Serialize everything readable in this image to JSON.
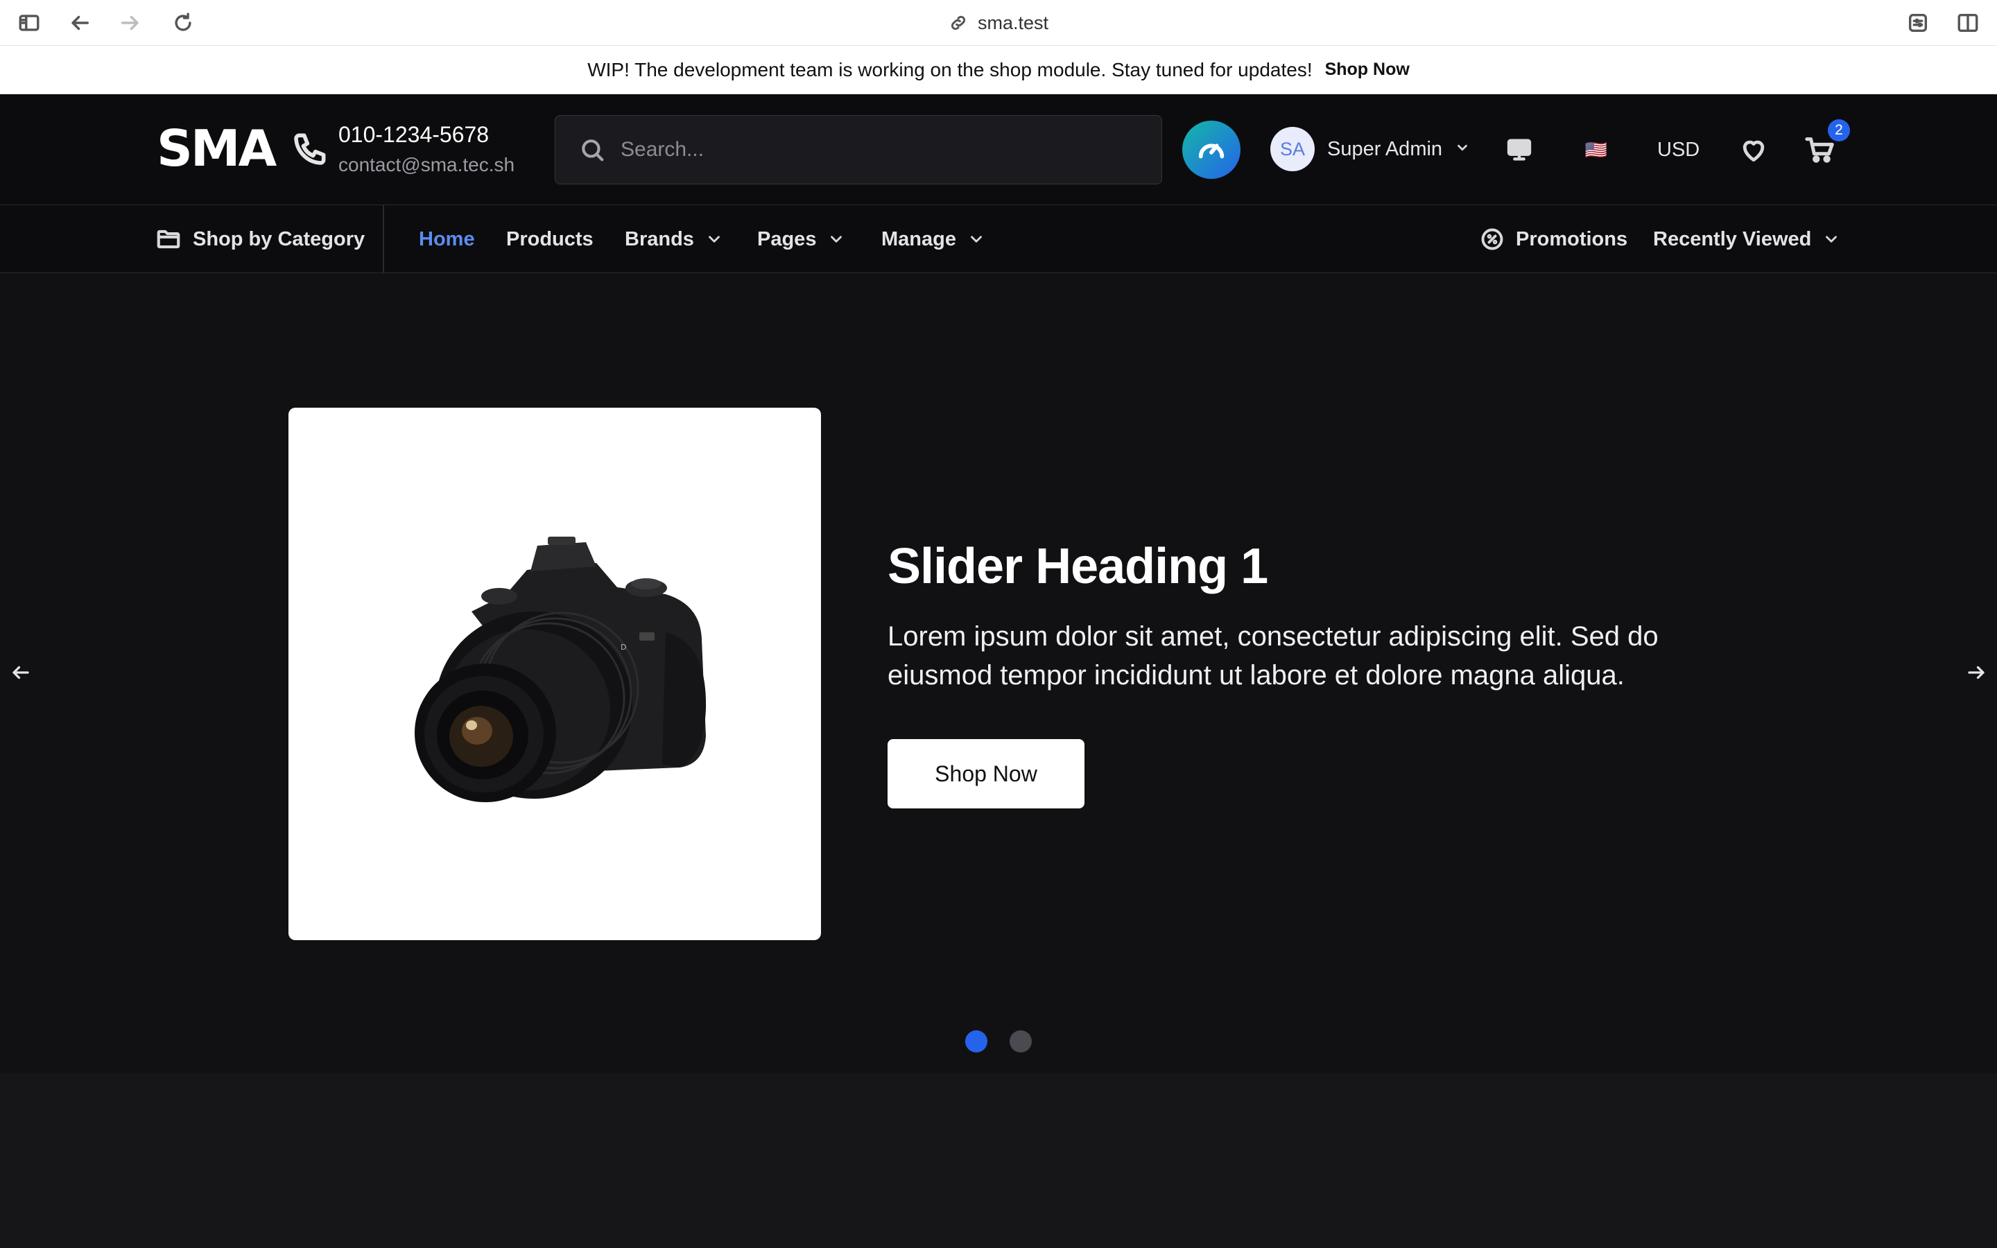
{
  "browser": {
    "url": "sma.test"
  },
  "announcement": {
    "text": "WIP! The development team is working on the shop module. Stay tuned for updates!",
    "link": "Shop Now"
  },
  "header": {
    "logo": "SMA",
    "phone": "010-1234-5678",
    "email": "contact@sma.tec.sh",
    "search_placeholder": "Search...",
    "user_initials": "SA",
    "user_name": "Super Admin",
    "currency": "USD",
    "flag": "🇺🇸",
    "cart_count": "2"
  },
  "nav": {
    "shop_by_category": "Shop by Category",
    "items": [
      {
        "label": "Home",
        "active": true
      },
      {
        "label": "Products"
      },
      {
        "label": "Brands"
      },
      {
        "label": "Pages"
      },
      {
        "label": "Manage"
      }
    ],
    "promotions": "Promotions",
    "recently_viewed": "Recently Viewed"
  },
  "hero": {
    "title": "Slider Heading 1",
    "text": "Lorem ipsum dolor sit amet, consectetur adipiscing elit. Sed do eiusmod tempor incididunt ut labore et dolore magna aliqua.",
    "button": "Shop Now",
    "image_icon": "camera-image",
    "active_slide": 1,
    "slide_count": 2
  },
  "colors": {
    "accent": "#2563eb",
    "nav_active": "#5b8def",
    "background": "#111113",
    "header_bg": "#0c0c0e"
  }
}
